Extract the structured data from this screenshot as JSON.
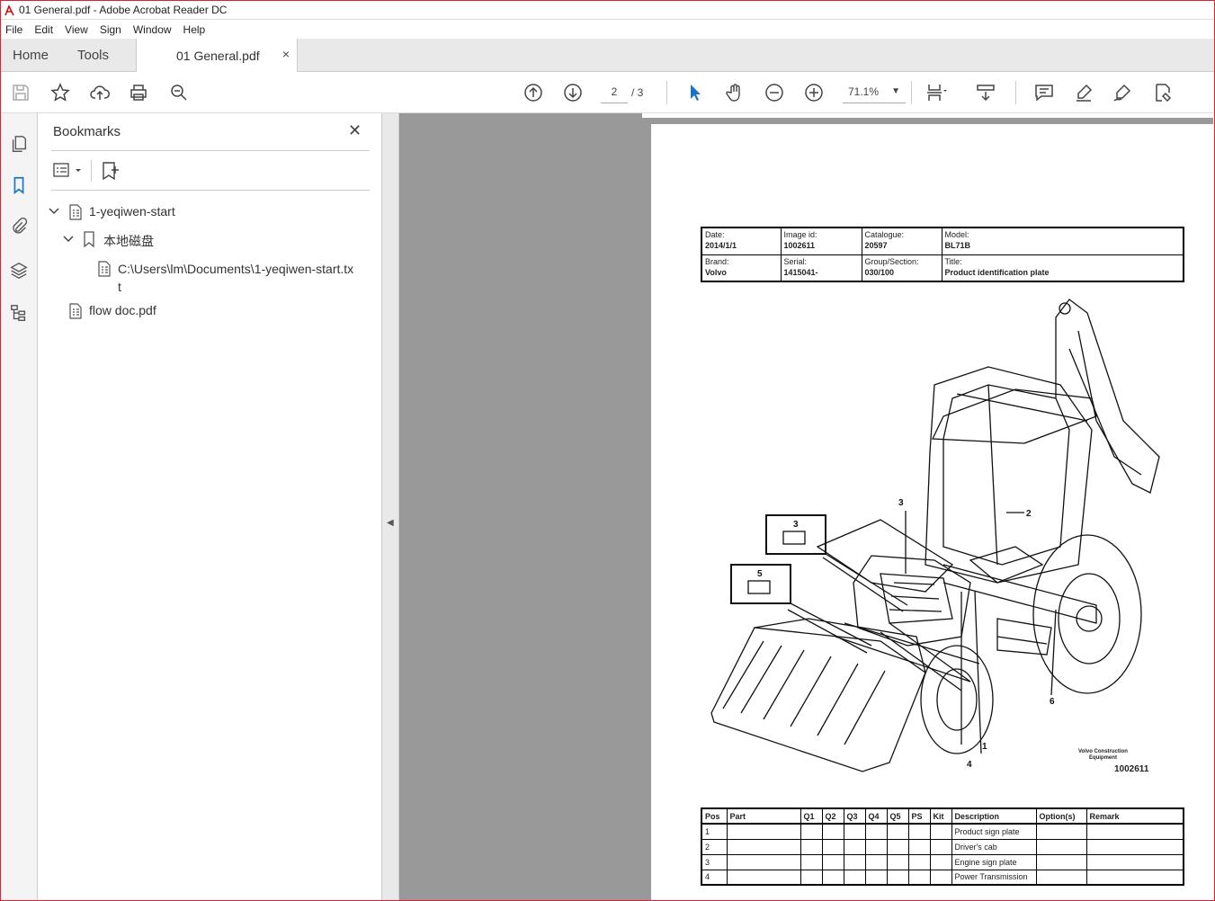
{
  "window": {
    "title": "01 General.pdf - Adobe Acrobat Reader DC"
  },
  "menu": [
    "File",
    "Edit",
    "View",
    "Sign",
    "Window",
    "Help"
  ],
  "tabs": {
    "home": "Home",
    "tools": "Tools",
    "doc": "01 General.pdf",
    "close": "×"
  },
  "toolbar": {
    "page_current": "2",
    "page_total": "/ 3",
    "zoom": "71.1%"
  },
  "bookmarks": {
    "title": "Bookmarks",
    "close": "✕",
    "items": [
      {
        "label": "1-yeqiwen-start"
      },
      {
        "label": "本地磁盘"
      },
      {
        "label": "C:\\Users\\lm\\Documents\\1-yeqiwen-start.tx"
      },
      {
        "label": "t"
      },
      {
        "label": "flow doc.pdf"
      }
    ]
  },
  "doc": {
    "header": {
      "date_label": "Date:",
      "date": "2014/1/1",
      "image_label": "Image id:",
      "image": "1002611",
      "catalogue_label": "Catalogue:",
      "catalogue": "20597",
      "model_label": "Model:",
      "model": "BL71B",
      "brand_label": "Brand:",
      "brand": "Volvo",
      "serial_label": "Serial:",
      "serial": "1415041-",
      "group_label": "Group/Section:",
      "group": "030/100",
      "title_label": "Title:",
      "title": "Product identification plate"
    },
    "callouts": [
      "1",
      "2",
      "3",
      "4",
      "5",
      "6",
      "3",
      "5"
    ],
    "vce_line1": "Volvo Construction",
    "vce_line2": "Equipment",
    "image_number": "1002611",
    "parts_headers": [
      "Pos",
      "Part",
      "Q1",
      "Q2",
      "Q3",
      "Q4",
      "Q5",
      "PS",
      "Kit",
      "Description",
      "Option(s)",
      "Remark"
    ],
    "parts_rows": [
      {
        "pos": "1",
        "desc": "Product sign plate"
      },
      {
        "pos": "2",
        "desc": "Driver's cab"
      },
      {
        "pos": "3",
        "desc": "Engine sign plate"
      },
      {
        "pos": "4",
        "desc": "Power Transmission"
      }
    ]
  }
}
